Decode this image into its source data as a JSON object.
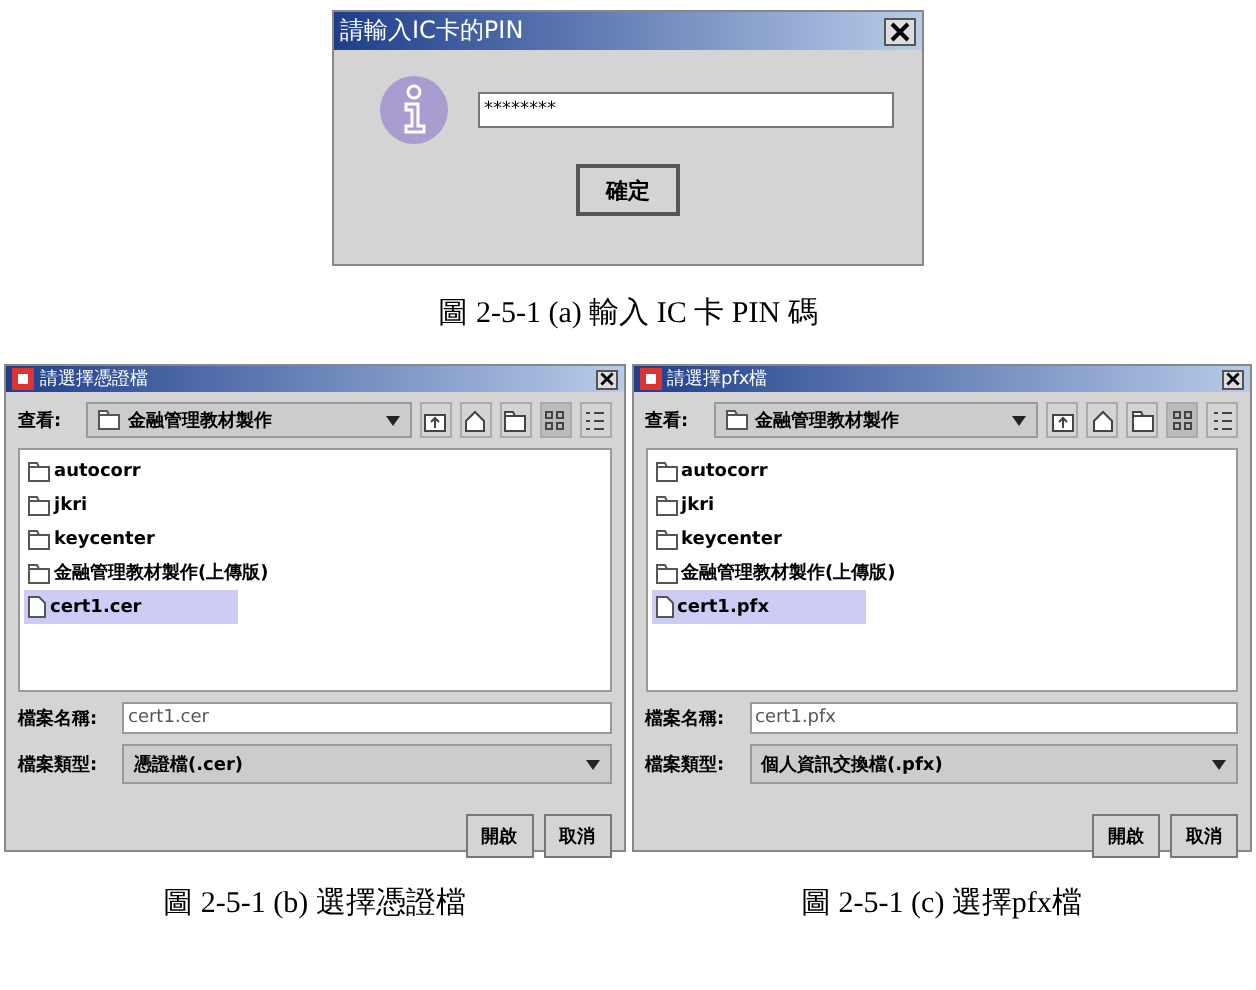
{
  "pin_dialog": {
    "title": "請輸入IC卡的PIN",
    "password": "********",
    "ok_button": "確定"
  },
  "caption_a": "圖 2-5-1 (a) 輸入 IC 卡 PIN 碼",
  "file_dialogs": [
    {
      "title": "請選擇憑證檔",
      "look_in_label": "查看:",
      "look_in_value": "金融管理教材製作",
      "files": [
        {
          "name": "autocorr",
          "kind": "folder",
          "selected": false
        },
        {
          "name": "jkri",
          "kind": "folder",
          "selected": false
        },
        {
          "name": "keycenter",
          "kind": "folder",
          "selected": false
        },
        {
          "name": "金融管理教材製作(上傳版)",
          "kind": "folder",
          "selected": false
        },
        {
          "name": "cert1.cer",
          "kind": "file",
          "selected": true
        }
      ],
      "filename_label": "檔案名稱:",
      "filename_value": "cert1.cer",
      "filetype_label": "檔案類型:",
      "filetype_value": "憑證檔(.cer)",
      "buttons": [
        "開啟",
        "取消"
      ],
      "caption": "圖 2-5-1 (b) 選擇憑證檔"
    },
    {
      "title": "請選擇pfx檔",
      "look_in_label": "查看:",
      "look_in_value": "金融管理教材製作",
      "files": [
        {
          "name": "autocorr",
          "kind": "folder",
          "selected": false
        },
        {
          "name": "jkri",
          "kind": "folder",
          "selected": false
        },
        {
          "name": "keycenter",
          "kind": "folder",
          "selected": false
        },
        {
          "name": "金融管理教材製作(上傳版)",
          "kind": "folder",
          "selected": false
        },
        {
          "name": "cert1.pfx",
          "kind": "file",
          "selected": true
        }
      ],
      "filename_label": "檔案名稱:",
      "filename_value": "cert1.pfx",
      "filetype_label": "檔案類型:",
      "filetype_value": "個人資訊交換檔(.pfx)",
      "buttons": [
        "開啟",
        "取消"
      ],
      "caption": "圖 2-5-1 (c) 選擇pfx檔"
    }
  ]
}
